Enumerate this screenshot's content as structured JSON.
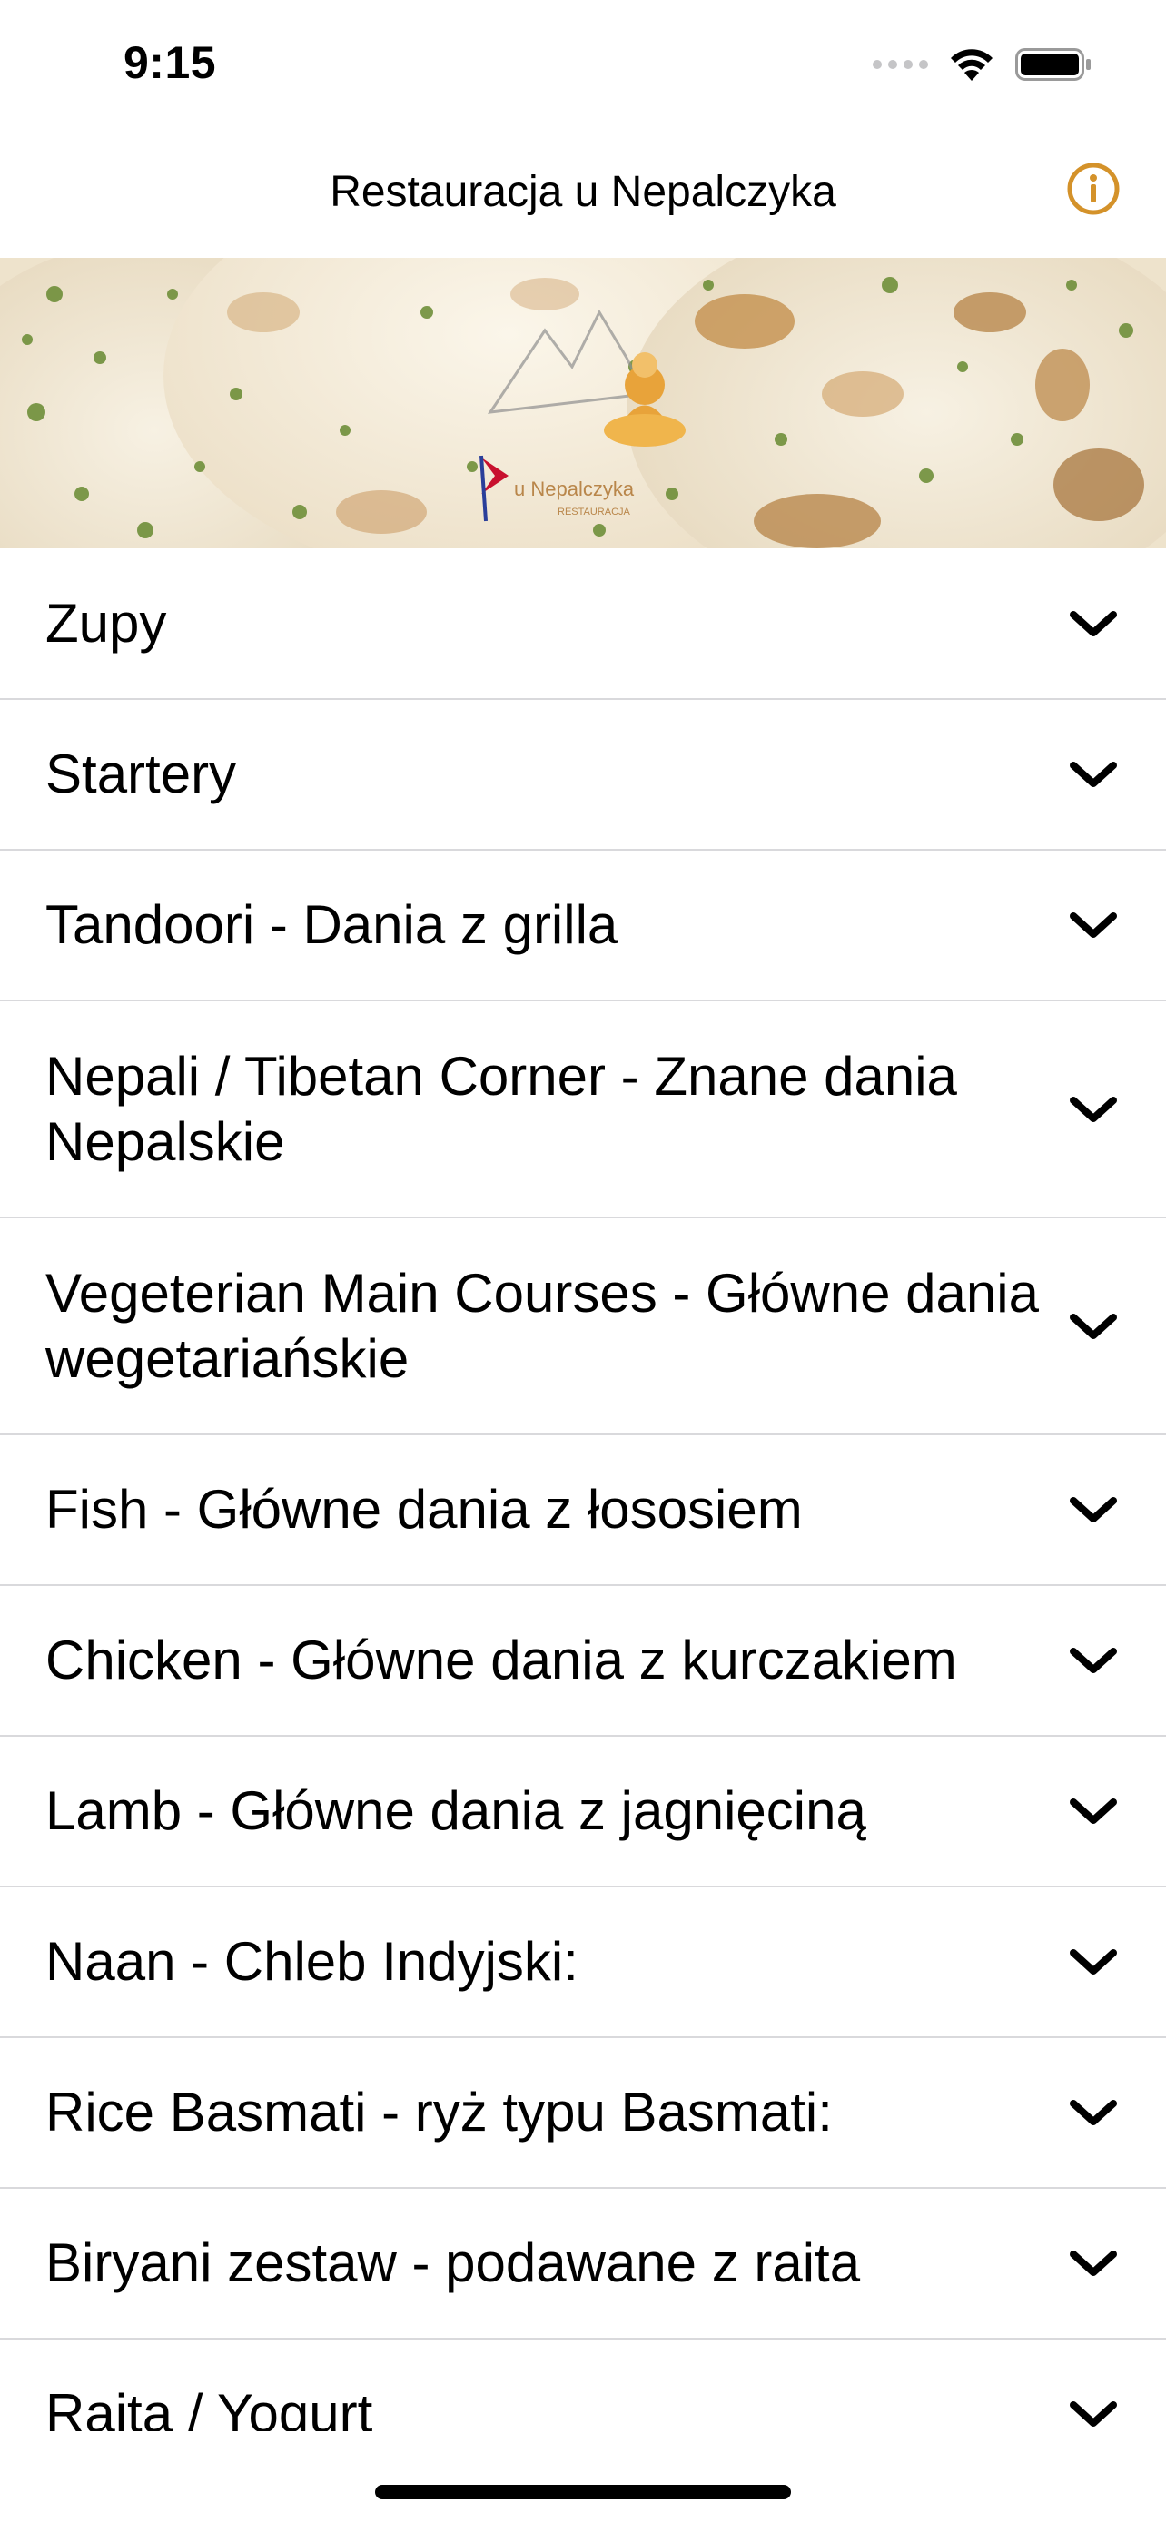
{
  "status_bar": {
    "time": "9:15",
    "icons": [
      "cellular-signal-icon",
      "wifi-icon",
      "battery-icon"
    ]
  },
  "nav": {
    "title": "Restauracja u Nepalczyka",
    "info_icon": "info-icon",
    "accent_color": "#d4922a"
  },
  "banner": {
    "logo_text": "u Nepalczyka",
    "logo_subtext": "RESTAURACJA"
  },
  "categories": [
    {
      "label": "Zupy"
    },
    {
      "label": "Startery"
    },
    {
      "label": "Tandoori - Dania z grilla"
    },
    {
      "label": "Nepali / Tibetan Corner - Znane dania Nepalskie"
    },
    {
      "label": "Vegeterian Main Courses - Główne dania wegetariańskie"
    },
    {
      "label": "Fish - Główne dania z łososiem"
    },
    {
      "label": "Chicken - Główne dania z kurczakiem"
    },
    {
      "label": "Lamb - Główne dania z jagnięciną"
    },
    {
      "label": "Naan - Chleb Indyjski:"
    },
    {
      "label": "Rice Basmati - ryż typu Basmati:"
    },
    {
      "label": "Biryani zestaw - podawane z raita"
    },
    {
      "label": "Raita / Yogurt"
    }
  ]
}
